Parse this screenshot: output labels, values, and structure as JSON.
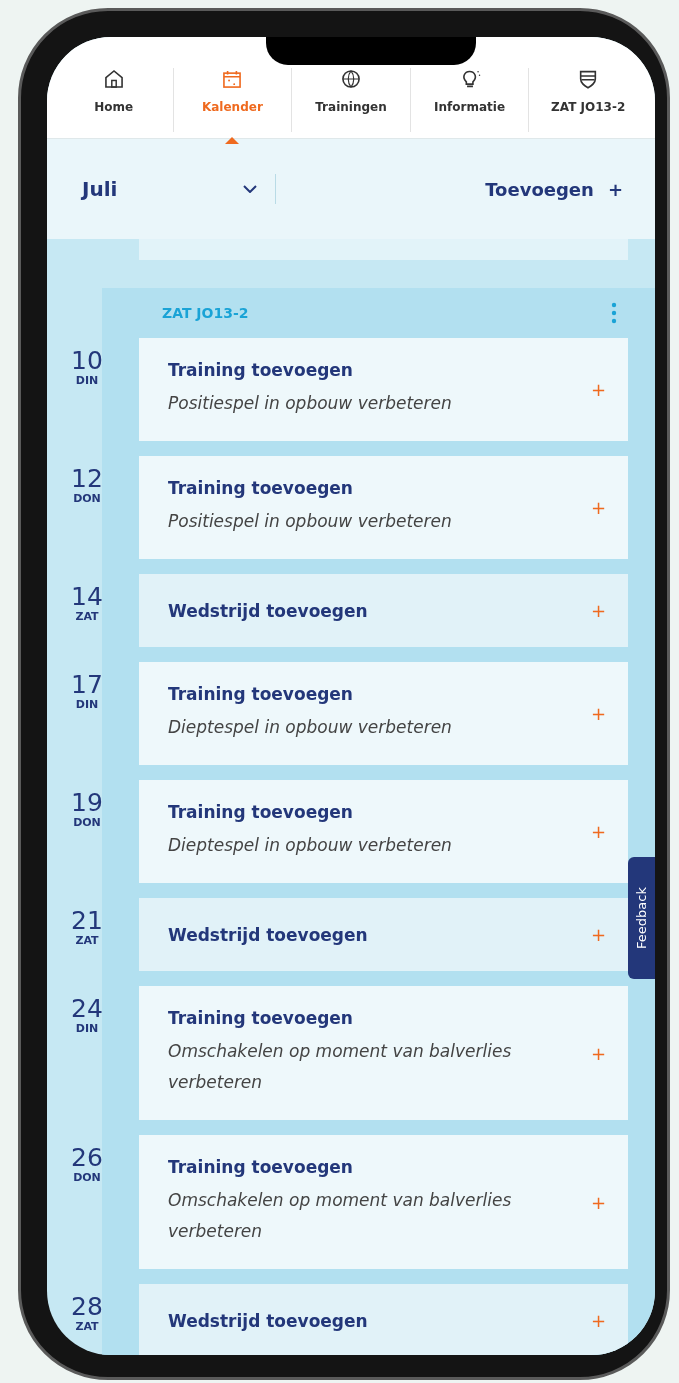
{
  "tabs": [
    {
      "label": "Home",
      "selected": false
    },
    {
      "label": "Kalender",
      "selected": true
    },
    {
      "label": "Trainingen",
      "selected": false
    },
    {
      "label": "Informatie",
      "selected": false
    },
    {
      "label": "ZAT JO13-2",
      "selected": false
    }
  ],
  "header": {
    "month": "Juli",
    "add_label": "Toevoegen",
    "add_icon": "+"
  },
  "group": {
    "title": "ZAT JO13-2",
    "events": [
      {
        "day": "10",
        "weekday": "DIN",
        "kind": "training",
        "title": "Training toevoegen",
        "subtitle": "Positiespel in opbouw verbeteren",
        "action": "+"
      },
      {
        "day": "12",
        "weekday": "DON",
        "kind": "training",
        "title": "Training toevoegen",
        "subtitle": "Positiespel in opbouw verbeteren",
        "action": "+"
      },
      {
        "day": "14",
        "weekday": "ZAT",
        "kind": "match",
        "title": "Wedstrijd toevoegen",
        "action": "+"
      },
      {
        "day": "17",
        "weekday": "DIN",
        "kind": "training",
        "title": "Training toevoegen",
        "subtitle": "Dieptespel in opbouw verbeteren",
        "action": "+"
      },
      {
        "day": "19",
        "weekday": "DON",
        "kind": "training",
        "title": "Training toevoegen",
        "subtitle": "Dieptespel in opbouw verbeteren",
        "action": "+"
      },
      {
        "day": "21",
        "weekday": "ZAT",
        "kind": "match",
        "title": "Wedstrijd toevoegen",
        "action": "+"
      },
      {
        "day": "24",
        "weekday": "DIN",
        "kind": "training",
        "title": "Training toevoegen",
        "subtitle": "Omschakelen op moment van balverlies verbeteren",
        "action": "+"
      },
      {
        "day": "26",
        "weekday": "DON",
        "kind": "training",
        "title": "Training toevoegen",
        "subtitle": "Omschakelen op moment van balverlies verbeteren",
        "action": "+"
      },
      {
        "day": "28",
        "weekday": "ZAT",
        "kind": "match",
        "title": "Wedstrijd toevoegen",
        "action": "+"
      }
    ]
  },
  "feedback": {
    "label": "Feedback"
  }
}
